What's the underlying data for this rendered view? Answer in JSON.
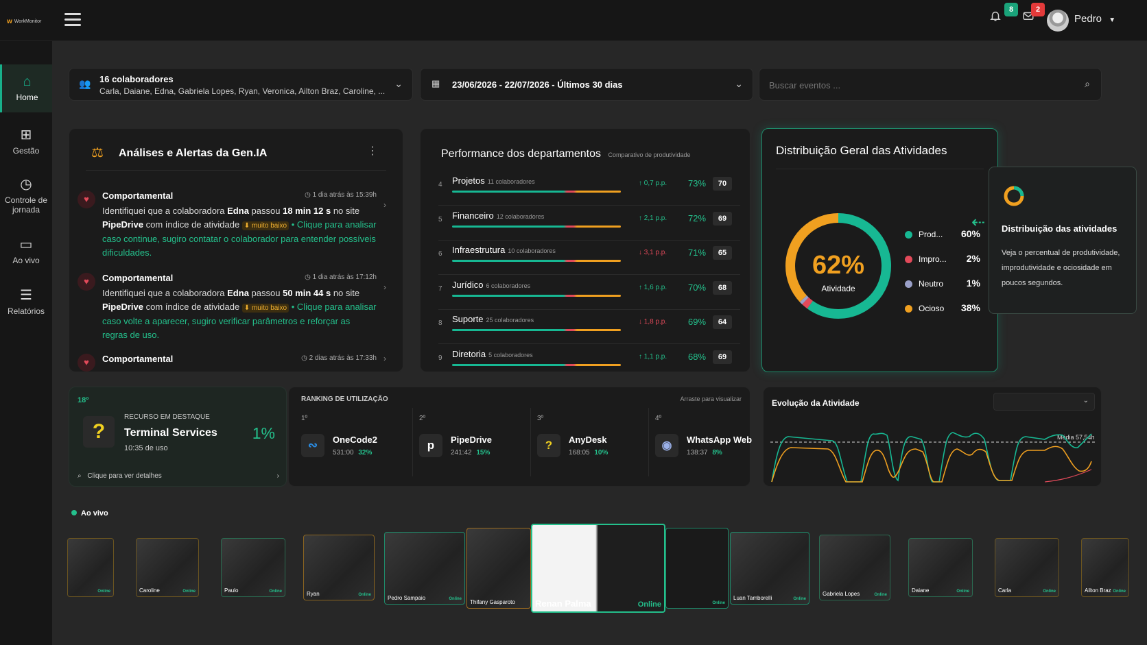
{
  "brand": {
    "name": "WorkMonitor"
  },
  "header": {
    "notifications_count": "8",
    "messages_count": "2",
    "user_name": "Pedro"
  },
  "nav": [
    {
      "label": "Home",
      "icon": "home-icon"
    },
    {
      "label": "Gestão",
      "icon": "plus-square-icon"
    },
    {
      "label": "Controle de jornada",
      "icon": "clock-icon"
    },
    {
      "label": "Ao vivo",
      "icon": "monitor-icon"
    },
    {
      "label": "Relatórios",
      "icon": "list-icon"
    }
  ],
  "filters": {
    "collaborators_title": "16 colaboradores",
    "collaborators_names": "Carla, Daiane, Edna, Gabriela Lopes, Ryan, Veronica, Ailton Braz, Caroline, ...",
    "date_range": "23/06/2026 - 22/07/2026 - Últimos 30 dias",
    "search_placeholder": "Buscar eventos ..."
  },
  "alerts": {
    "title": "Análises e Alertas da Gen.IA",
    "items": [
      {
        "type": "Comportamental",
        "time": "1 dia atrás às 15:39h",
        "text_a": "Identifiquei que a colaboradora ",
        "name": "Edna",
        "text_b": " passou ",
        "duration": "18 min 12 s",
        "text_c": " no site ",
        "site": "PipeDrive",
        "text_d": " com índice de atividade ",
        "tag": "muito baixo",
        "cta": " • Clique para analisar caso continue, sugiro contatar o colaborador para entender possíveis dificuldades."
      },
      {
        "type": "Comportamental",
        "time": "1 dia atrás às 17:12h",
        "text_a": "Identifiquei que a colaboradora ",
        "name": "Edna",
        "text_b": " passou ",
        "duration": "50 min 44 s",
        "text_c": " no site ",
        "site": "PipeDrive",
        "text_d": " com índice de atividade ",
        "tag": "muito baixo",
        "cta": " • Clique para analisar caso volte a aparecer, sugiro verificar parâmetros e reforçar as regras de uso."
      },
      {
        "type": "Comportamental",
        "time": "2 dias atrás às 17:33h"
      }
    ]
  },
  "performance": {
    "title": "Performance dos departamentos",
    "subtitle": "Comparativo de produtividade",
    "rows": [
      {
        "idx": "4",
        "name": "Projetos",
        "sub": "11 colaboradores",
        "delta": "↑ 0,7 p.p.",
        "dir": "up",
        "pct": "73%",
        "score": "70"
      },
      {
        "idx": "5",
        "name": "Financeiro",
        "sub": "12 colaboradores",
        "delta": "↑ 2,1 p.p.",
        "dir": "up",
        "pct": "72%",
        "score": "69"
      },
      {
        "idx": "6",
        "name": "Infraestrutura",
        "sub": "10 colaboradores",
        "delta": "↓ 3,1 p.p.",
        "dir": "down",
        "pct": "71%",
        "score": "65"
      },
      {
        "idx": "7",
        "name": "Jurídico",
        "sub": "6 colaboradores",
        "delta": "↑ 1,6 p.p.",
        "dir": "up",
        "pct": "70%",
        "score": "68"
      },
      {
        "idx": "8",
        "name": "Suporte",
        "sub": "25 colaboradores",
        "delta": "↓ 1,8 p.p.",
        "dir": "down",
        "pct": "69%",
        "score": "64"
      },
      {
        "idx": "9",
        "name": "Diretoria",
        "sub": "5 colaboradores",
        "delta": "↑ 1,1 p.p.",
        "dir": "up",
        "pct": "68%",
        "score": "69"
      }
    ]
  },
  "distribution": {
    "title": "Distribuição Geral das Atividades",
    "center_value": "62%",
    "center_label": "Atividade",
    "legend": [
      {
        "label": "Prod...",
        "value": "60%",
        "color": "#17b893"
      },
      {
        "label": "Impro...",
        "value": "2%",
        "color": "#e24a5a"
      },
      {
        "label": "Neutro",
        "value": "1%",
        "color": "#9aa0c8"
      },
      {
        "label": "Ocioso",
        "value": "38%",
        "color": "#f0a020"
      }
    ]
  },
  "tooltip": {
    "title": "Distribuição das atividades",
    "text": "Veja o percentual de produtividade, improdutividade e ociosidade em poucos segundos."
  },
  "featured": {
    "rank": "18º",
    "label": "RECURSO EM DESTAQUE",
    "name": "Terminal Services",
    "time": "10:35 de uso",
    "pct": "1%",
    "link": "Clique para ver detalhes"
  },
  "ranking": {
    "title": "RANKING DE UTILIZAÇÃO",
    "hint": "Arraste para visualizar",
    "items": [
      {
        "pos": "1º",
        "name": "OneCode2",
        "time": "531:00",
        "pct": "32%",
        "glyph": "∾"
      },
      {
        "pos": "2º",
        "name": "PipeDrive",
        "time": "241:42",
        "pct": "15%",
        "glyph": "p"
      },
      {
        "pos": "3º",
        "name": "AnyDesk",
        "time": "168:05",
        "pct": "10%",
        "glyph": "?"
      },
      {
        "pos": "4º",
        "name": "WhatsApp Web",
        "time": "138:37",
        "pct": "8%",
        "glyph": "◉"
      }
    ]
  },
  "evolution": {
    "title": "Evolução da Atividade",
    "avg_label": "Média 57,54h"
  },
  "live": {
    "label": "Ao vivo",
    "thumbs": [
      {
        "name": "",
        "status": "Online"
      },
      {
        "name": "Caroline",
        "status": "Online"
      },
      {
        "name": "Paulo",
        "status": "Online"
      },
      {
        "name": "Ryan",
        "status": "Online"
      },
      {
        "name": "Pedro Sampaio",
        "status": "Online"
      },
      {
        "name": "Thifany Gasparoto",
        "status": ""
      },
      {
        "name": "Renan Palma",
        "status": "Online"
      },
      {
        "name": "",
        "status": "Online"
      },
      {
        "name": "Luan Tamborelli",
        "status": "Online"
      },
      {
        "name": "Gabriela Lopes",
        "status": "Online"
      },
      {
        "name": "Daiane",
        "status": "Online"
      },
      {
        "name": "Carla",
        "status": "Online"
      },
      {
        "name": "Ailton Braz",
        "status": "Online"
      }
    ]
  }
}
